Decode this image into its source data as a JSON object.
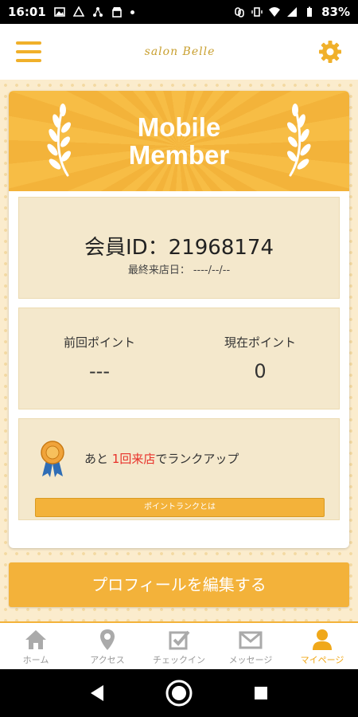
{
  "status_bar": {
    "time": "16:01",
    "battery": "83%"
  },
  "app_bar": {
    "title": "salon Belle"
  },
  "card": {
    "title_line1": "Mobile",
    "title_line2": "Member"
  },
  "member": {
    "id_label": "会員ID：",
    "id_value": "21968174",
    "last_visit_label": "最終来店日：",
    "last_visit_value": "----/--/--"
  },
  "points": {
    "previous_label": "前回ポイント",
    "previous_value": "---",
    "current_label": "現在ポイント",
    "current_value": "0"
  },
  "rank": {
    "prefix": "あと",
    "highlight": "1回来店",
    "suffix": "でランクアップ",
    "button_label": "ポイントランクとは"
  },
  "profile_button_label": "プロフィールを編集する",
  "bottom_nav": {
    "items": [
      {
        "label": "ホーム",
        "icon": "home-icon"
      },
      {
        "label": "アクセス",
        "icon": "map-pin-icon"
      },
      {
        "label": "チェックイン",
        "icon": "checkbox-icon"
      },
      {
        "label": "メッセージ",
        "icon": "envelope-icon"
      },
      {
        "label": "マイページ",
        "icon": "person-icon",
        "active": true
      }
    ]
  },
  "colors": {
    "accent": "#f3b23a",
    "highlight_red": "#e8312a",
    "nav_inactive": "#999999",
    "nav_active": "#f0a81a"
  }
}
